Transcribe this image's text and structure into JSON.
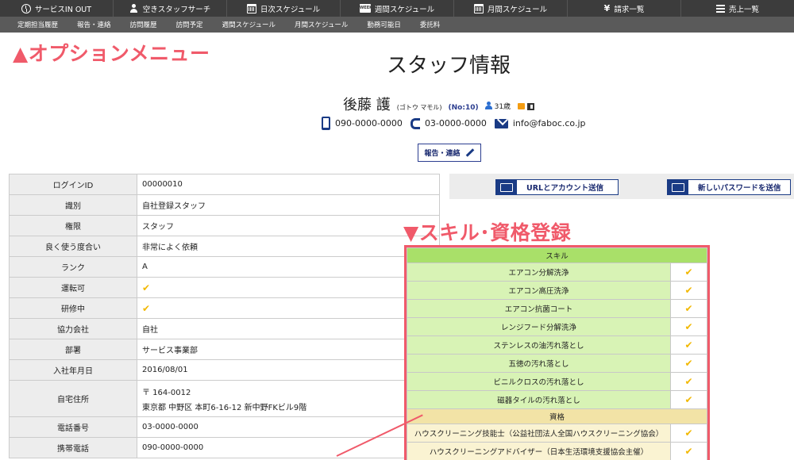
{
  "topnav": [
    {
      "label": "サービスIN OUT",
      "icon": "clock-icon"
    },
    {
      "label": "空きスタッフサーチ",
      "icon": "person-icon"
    },
    {
      "label": "日次スケジュール",
      "icon": "calendar-icon"
    },
    {
      "label": "週間スケジュール",
      "icon": "week-calendar-icon",
      "badge": "WEEK"
    },
    {
      "label": "月間スケジュール",
      "icon": "month-calendar-icon"
    },
    {
      "label": "請求一覧",
      "icon": "yen-icon",
      "glyph": "¥"
    },
    {
      "label": "売上一覧",
      "icon": "list-icon"
    }
  ],
  "subnav": [
    "定期担当履歴",
    "報告・連絡",
    "訪問履歴",
    "訪問予定",
    "週間スケジュール",
    "月間スケジュール",
    "勤務可能日",
    "委託料"
  ],
  "annotations": {
    "option_menu": "▲オプションメニュー",
    "skill_register": "▼スキル･資格登録"
  },
  "page": {
    "title": "スタッフ情報"
  },
  "staff": {
    "name": "後藤 護",
    "kana": "(ゴトウ マモル)",
    "no": "(No:10)",
    "age": "31歳",
    "mobile": "090-0000-0000",
    "phone": "03-0000-0000",
    "email": "info@faboc.co.jp"
  },
  "report_button": {
    "label": "報告・連絡"
  },
  "staff_table": {
    "rows": [
      {
        "key": "ログインID",
        "value": "00000010"
      },
      {
        "key": "識別",
        "value": "自社登録スタッフ"
      },
      {
        "key": "権限",
        "value": "スタッフ"
      },
      {
        "key": "良く使う度合い",
        "value": "非常によく依頼"
      },
      {
        "key": "ランク",
        "value": "A"
      },
      {
        "key": "運転可",
        "value": "✔"
      },
      {
        "key": "研修中",
        "value": "✔"
      },
      {
        "key": "協力会社",
        "value": "自社"
      },
      {
        "key": "部署",
        "value": "サービス事業部"
      },
      {
        "key": "入社年月日",
        "value": "2016/08/01"
      },
      {
        "key": "自宅住所",
        "value": "〒 164-0012",
        "value2": "東京都 中野区 本町6-16-12 新中野FKビル9階"
      },
      {
        "key": "電話番号",
        "value": "03-0000-0000"
      },
      {
        "key": "携帯電話",
        "value": "090-0000-0000"
      }
    ]
  },
  "actions": {
    "url_account": "URLとアカウント送信",
    "new_password": "新しいパスワードを送信"
  },
  "skills": {
    "skill_header": "スキル",
    "skill_items": [
      {
        "name": "エアコン分解洗浄",
        "checked": "✔"
      },
      {
        "name": "エアコン高圧洗浄",
        "checked": "✔"
      },
      {
        "name": "エアコン抗菌コート",
        "checked": "✔"
      },
      {
        "name": "レンジフード分解洗浄",
        "checked": "✔"
      },
      {
        "name": "ステンレスの油汚れ落とし",
        "checked": "✔"
      },
      {
        "name": "五徳の汚れ落とし",
        "checked": "✔"
      },
      {
        "name": "ビニルクロスの汚れ落とし",
        "checked": "✔"
      },
      {
        "name": "磁器タイルの汚れ落とし",
        "checked": "✔"
      }
    ],
    "qual_header": "資格",
    "qual_items": [
      {
        "name": "ハウスクリーニング技能士（公益社団法人全国ハウスクリーニング協会）",
        "checked": "✔"
      },
      {
        "name": "ハウスクリーニングアドバイザー（日本生活環境支援協会主催）",
        "checked": "✔"
      }
    ]
  },
  "colors": {
    "topnav_bg": "#3c3c3c",
    "subnav_bg": "#5a5a5a",
    "annotation": "#f05a6a",
    "accent_navy": "#1a3b85",
    "skill_header": "#a9e069",
    "qual_header": "#f2e3a6",
    "check": "#f2b800"
  }
}
